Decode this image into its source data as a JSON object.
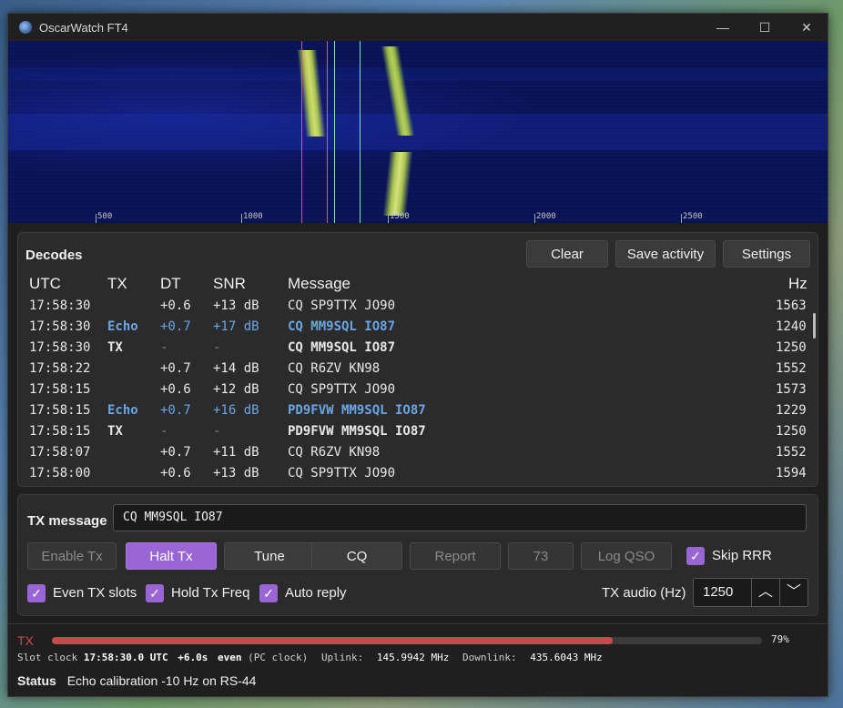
{
  "window": {
    "title": "OscarWatch FT4",
    "minimize": "—",
    "maximize": "☐",
    "close": "✕"
  },
  "waterfall": {
    "ticks": [
      "500",
      "1000",
      "1500",
      "2000",
      "2500"
    ]
  },
  "decodes": {
    "title": "Decodes",
    "buttons": {
      "clear": "Clear",
      "save": "Save activity",
      "settings": "Settings"
    },
    "columns": {
      "utc": "UTC",
      "tx": "TX",
      "dt": "DT",
      "snr": "SNR",
      "message": "Message",
      "hz": "Hz"
    },
    "rows": [
      {
        "utc": "17:58:30",
        "tx": "",
        "dt": "+0.6",
        "snr": "+13 dB",
        "message": "CQ SP9TTX JO90",
        "hz": "1563"
      },
      {
        "utc": "17:58:30",
        "tx": "Echo",
        "dt": "+0.7",
        "snr": "+17 dB",
        "message": "CQ MM9SQL IO87",
        "hz": "1240"
      },
      {
        "utc": "17:58:30",
        "tx": "TX",
        "dt": "-",
        "snr": "-",
        "message": "CQ MM9SQL IO87",
        "hz": "1250"
      },
      {
        "utc": "17:58:22",
        "tx": "",
        "dt": "+0.7",
        "snr": "+14 dB",
        "message": "CQ R6ZV KN98",
        "hz": "1552"
      },
      {
        "utc": "17:58:15",
        "tx": "",
        "dt": "+0.6",
        "snr": "+12 dB",
        "message": "CQ SP9TTX JO90",
        "hz": "1573"
      },
      {
        "utc": "17:58:15",
        "tx": "Echo",
        "dt": "+0.7",
        "snr": "+16 dB",
        "message": "PD9FVW MM9SQL IO87",
        "hz": "1229"
      },
      {
        "utc": "17:58:15",
        "tx": "TX",
        "dt": "-",
        "snr": "-",
        "message": "PD9FVW MM9SQL IO87",
        "hz": "1250"
      },
      {
        "utc": "17:58:07",
        "tx": "",
        "dt": "+0.7",
        "snr": "+11 dB",
        "message": "CQ R6ZV KN98",
        "hz": "1552"
      },
      {
        "utc": "17:58:00",
        "tx": "",
        "dt": "+0.6",
        "snr": "+13 dB",
        "message": "CQ SP9TTX JO90",
        "hz": "1594"
      }
    ]
  },
  "tx": {
    "label": "TX message",
    "message": "CQ MM9SQL IO87",
    "buttons": {
      "enable": "Enable Tx",
      "halt": "Halt Tx",
      "tune": "Tune",
      "cq": "CQ",
      "report": "Report",
      "r73": "73",
      "log": "Log QSO"
    },
    "checks": {
      "skip_rrr": "Skip RRR",
      "even_slots": "Even TX slots",
      "hold_freq": "Hold Tx Freq",
      "auto_reply": "Auto reply"
    },
    "audio_label": "TX audio (Hz)",
    "audio_value": "1250"
  },
  "status": {
    "tx_label": "TX",
    "progress_pct": 79,
    "progress_text": "79%",
    "slot_clock_label": "Slot clock",
    "slot_clock": "17:58:30.0 UTC",
    "offset": "+6.0s",
    "parity": "even",
    "clock_src": "(PC clock)",
    "uplink_label": "Uplink:",
    "uplink": "145.9942 MHz",
    "downlink_label": "Downlink:",
    "downlink": "435.6043 MHz",
    "status_label": "Status",
    "status_text": "Echo calibration -10 Hz on RS-44"
  },
  "colors": {
    "accent": "#9a66d6",
    "echo": "#6aa6e6",
    "progress": "#c94a4a"
  }
}
